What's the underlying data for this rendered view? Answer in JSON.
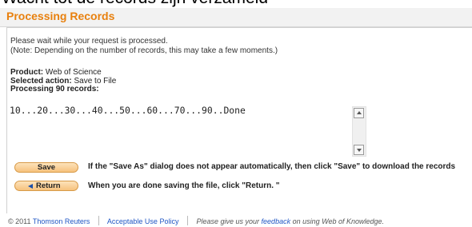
{
  "caption": "Wacht tot de records zijn verzameld",
  "header": {
    "title": "Processing Records"
  },
  "message": {
    "line1": "Please wait while your request is processed.",
    "line2": "(Note: Depending on the number of records, this may take a few moments.)"
  },
  "meta": {
    "product_label": "Product:",
    "product_value": "Web of Science",
    "action_label": "Selected action:",
    "action_value": "Save to File",
    "processing_label": "Processing 90 records:"
  },
  "progress": {
    "text": "10...20...30...40...50...60...70...90..Done"
  },
  "buttons": {
    "save": "Save",
    "return": "Return"
  },
  "hints": {
    "save": "If the \"Save As\" dialog does not appear automatically, then click \"Save\" to download the records",
    "return": "When you are done saving the file, click \"Return. \""
  },
  "footer": {
    "copyright": "© 2011",
    "company": "Thomson Reuters",
    "policy": "Acceptable Use Policy",
    "feedback_prefix": "Please give us your",
    "feedback_link": "feedback",
    "feedback_suffix": "on using Web of Knowledge."
  },
  "colors": {
    "accent": "#e8800e",
    "link": "#1f56c4",
    "button": "#f6c27d"
  },
  "icons": {
    "scroll_up": "scroll-up-icon",
    "scroll_down": "scroll-down-icon",
    "return_arrow": "left-arrow-icon"
  }
}
